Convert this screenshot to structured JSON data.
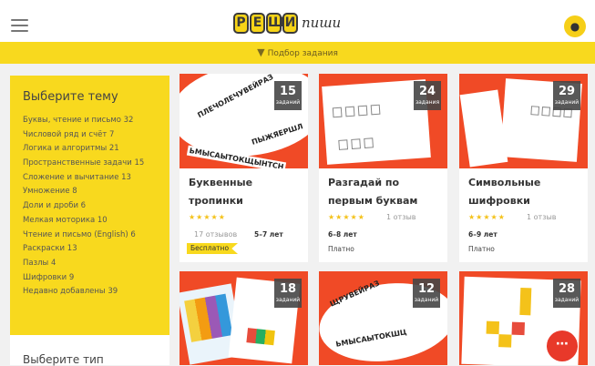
{
  "header": {
    "logo_main": [
      "Р",
      "Е",
      "Ш",
      "И"
    ],
    "logo_sub": "пиши",
    "avatar_icon": "user-icon"
  },
  "filter_bar": {
    "label": "Подбор задания",
    "icon": "filter-icon"
  },
  "sidebar": {
    "topic_heading": "Выберите тему",
    "topics": [
      "Буквы, чтение и письмо 32",
      "Числовой ряд и счёт 7",
      "Логика и алгоритмы 21",
      "Пространственные задачи 15",
      "Сложение и вычитание 13",
      "Умножение 8",
      "Доли и дроби 6",
      "Мелкая моторика 10",
      "Чтение и письмо (English) 6",
      "Раскраски 13",
      "Пазлы 4",
      "Шифровки 9",
      "Недавно добавлены 39"
    ],
    "type_heading": "Выберите тип"
  },
  "cards": [
    {
      "count": "15",
      "count_label": "заданий",
      "title": "Буквенные тропинки",
      "stars": "★★★★★",
      "reviews": "17 отзывов",
      "age": "5–7 лет",
      "price": "Бесплатно",
      "free": true
    },
    {
      "count": "24",
      "count_label": "задания",
      "title": "Разгадай по первым буквам",
      "stars": "★★★★★",
      "reviews": "1 отзыв",
      "age": "6–8 лет",
      "price": "Платно",
      "free": false
    },
    {
      "count": "29",
      "count_label": "заданий",
      "title": "Символьные шифровки",
      "stars": "★★★★★",
      "reviews": "1 отзыв",
      "age": "6–9 лет",
      "price": "Платно",
      "free": false
    },
    {
      "count": "18",
      "count_label": "заданий"
    },
    {
      "count": "12",
      "count_label": "заданий"
    },
    {
      "count": "28",
      "count_label": "заданий"
    }
  ],
  "thumb_words": {
    "card1": [
      "ПЛЕЧОЛЕЧУВЕЙРАЗ",
      "ПЫЖЯЕРШЛ",
      "ЬМЫСАЫТОКЩЫНТСН"
    ],
    "card5": [
      "ЩРУВЕЙРАЗ",
      "ЬМЫСАЫТОКШЦ"
    ]
  },
  "chat_icon": "chat-icon",
  "colors": {
    "accent": "#f8d91e",
    "thumb_bg": "#f04a26",
    "badge_bg": "#464646",
    "fab": "#e8392a"
  }
}
